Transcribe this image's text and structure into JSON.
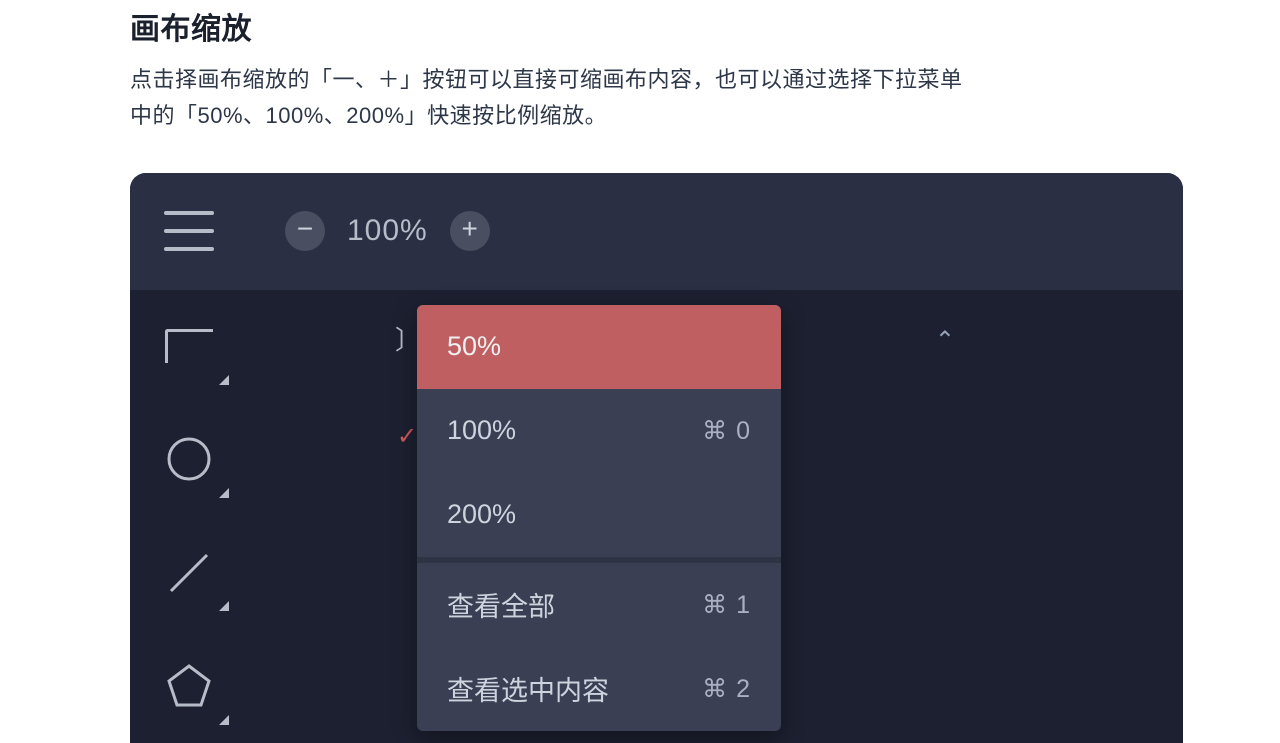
{
  "doc": {
    "title": "画布缩放",
    "body": "点击择画布缩放的「一、＋」按钮可以直接可缩画布内容，也可以通过选择下拉菜单中的「50%、100%、200%」快速按比例缩放。"
  },
  "toolbar": {
    "minus_glyph": "−",
    "plus_glyph": "+",
    "zoom_value": "100%"
  },
  "panel": {
    "chevron_up_glyph": "⌃",
    "hint_glyph": "〕",
    "check_glyph": "✓"
  },
  "menu": {
    "items": [
      {
        "label": "50%",
        "shortcut": ""
      },
      {
        "label": "100%",
        "shortcut": "⌘ 0"
      },
      {
        "label": "200%",
        "shortcut": ""
      }
    ],
    "items2": [
      {
        "label": "查看全部",
        "shortcut": "⌘ 1"
      },
      {
        "label": "查看选中内容",
        "shortcut": "⌘ 2"
      }
    ]
  }
}
